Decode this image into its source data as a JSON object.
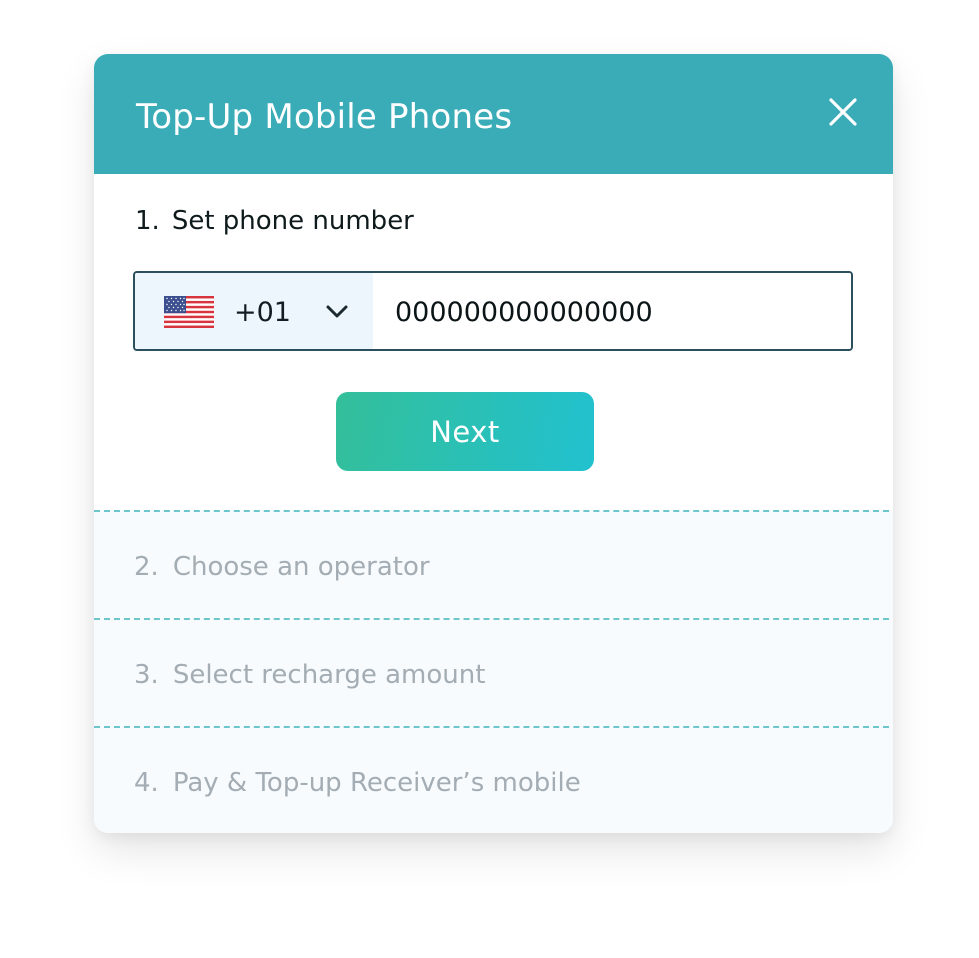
{
  "modal": {
    "title": "Top-Up Mobile Phones",
    "close_icon": "close-icon"
  },
  "step1": {
    "number": "1.",
    "title": "Set phone number"
  },
  "phone": {
    "country_flag": "us-flag-icon",
    "dial_code": "+01",
    "dropdown_icon": "chevron-down-icon",
    "number_value": "000000000000000"
  },
  "next_button": {
    "label": "Next"
  },
  "pending_steps": [
    {
      "number": "2.",
      "title": "Choose an operator"
    },
    {
      "number": "3.",
      "title": "Select recharge amount"
    },
    {
      "number": "4.",
      "title": "Pay & Top-up Receiver’s mobile"
    }
  ],
  "colors": {
    "header": "#3aacb8",
    "button_gradient_start": "#34bf9a",
    "button_gradient_end": "#21c1cf",
    "input_border": "#2b4f5c",
    "pending_text": "#a3adb3",
    "divider": "#6ec6cd"
  }
}
